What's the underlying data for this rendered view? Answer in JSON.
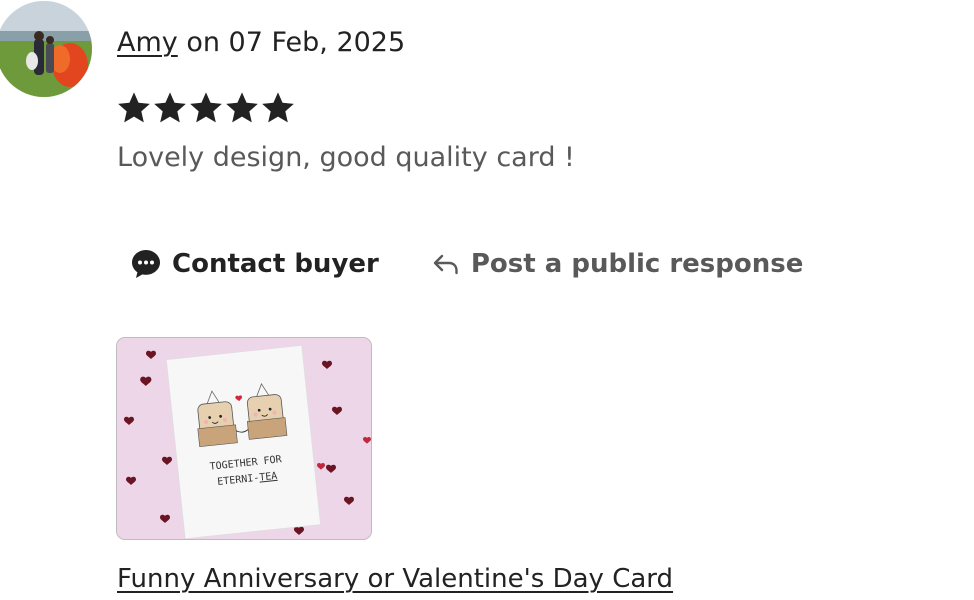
{
  "review": {
    "reviewer_name": "Amy",
    "date_text": " on 07 Feb, 2025",
    "rating": 5,
    "text": "Lovely design, good quality card !"
  },
  "actions": {
    "contact_label": "Contact buyer",
    "contact_icon": "chat-bubble-icon",
    "public_label": "Post a public response",
    "public_icon": "reply-arrow-icon"
  },
  "listing": {
    "title": "Funny Anniversary or Valentine's Day Card",
    "card_text_line1": "TOGETHER FOR",
    "card_text_line2_prefix": "ETERNI-",
    "card_text_line2_suffix": "TEA"
  },
  "colors": {
    "text_primary": "#222222",
    "text_secondary": "#595959",
    "thumb_background": "#ecd6e8",
    "heart": "#7a1a2a"
  }
}
